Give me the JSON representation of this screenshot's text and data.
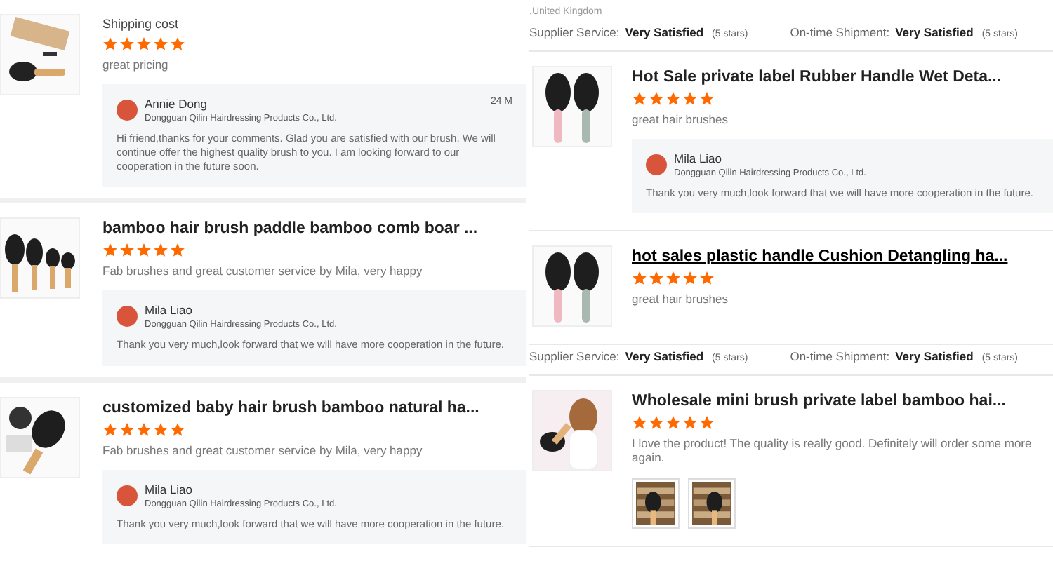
{
  "left_column": [
    {
      "kind": "review",
      "title": {
        "kind": "fee",
        "text": "Shipping cost"
      },
      "stars": 5,
      "comment": "great pricing",
      "reply": {
        "name": "Annie Dong",
        "company": "Dongguan Qilin Hairdressing Products Co., Ltd.",
        "date": "24 M",
        "text": "Hi friend,thanks for your comments. Glad you are satisfied with our brush. We will continue offer the highest quality brush to you. I am looking forward to our cooperation in the future soon."
      }
    },
    {
      "kind": "review",
      "title": {
        "kind": "product",
        "text": "bamboo hair brush paddle bamboo comb boar ..."
      },
      "stars": 5,
      "comment": "Fab brushes and great customer service by Mila, very happy",
      "reply": {
        "name": "Mila Liao",
        "company": "Dongguan Qilin Hairdressing Products Co., Ltd.",
        "text": "Thank you very much,look forward that we will have more cooperation in the future."
      }
    },
    {
      "kind": "review",
      "title": {
        "kind": "product",
        "text": "customized baby hair brush bamboo natural ha..."
      },
      "stars": 5,
      "comment": "Fab brushes and great customer service by Mila, very happy",
      "reply": {
        "name": "Mila Liao",
        "company": "Dongguan Qilin Hairdressing Products Co., Ltd.",
        "text": "Thank you very much,look forward that we will have more cooperation in the future."
      }
    }
  ],
  "right_column": [
    {
      "kind": "location",
      "text": ",United Kingdom"
    },
    {
      "kind": "ratings",
      "items": [
        {
          "label": "Supplier Service:",
          "value": "Very Satisfied",
          "note": "(5 stars)"
        },
        {
          "label": "On-time Shipment:",
          "value": "Very Satisfied",
          "note": "(5 stars)"
        }
      ]
    },
    {
      "kind": "review",
      "title": {
        "kind": "product",
        "text": "Hot Sale private label Rubber Handle Wet Deta...",
        "hovered": false
      },
      "stars": 5,
      "comment": "great hair brushes",
      "reply": {
        "name": "Mila Liao",
        "company": "Dongguan Qilin Hairdressing Products Co., Ltd.",
        "text": "Thank you very much,look forward that we will have more cooperation in the future."
      }
    },
    {
      "kind": "review",
      "title": {
        "kind": "product",
        "text": "hot sales plastic handle Cushion Detangling ha...",
        "hovered": true
      },
      "stars": 5,
      "comment": "great hair brushes"
    },
    {
      "kind": "ratings",
      "items": [
        {
          "label": "Supplier Service:",
          "value": "Very Satisfied",
          "note": "(5 stars)"
        },
        {
          "label": "On-time Shipment:",
          "value": "Very Satisfied",
          "note": "(5 stars)"
        }
      ]
    },
    {
      "kind": "review",
      "title": {
        "kind": "product",
        "text": "Wholesale mini brush private label bamboo hai...",
        "hovered": false
      },
      "stars": 5,
      "comment": "I love the product! The quality is really good. Definitely will order some more again.",
      "photos": [
        {
          "kind": "picture"
        },
        {
          "kind": "picture"
        }
      ]
    }
  ]
}
